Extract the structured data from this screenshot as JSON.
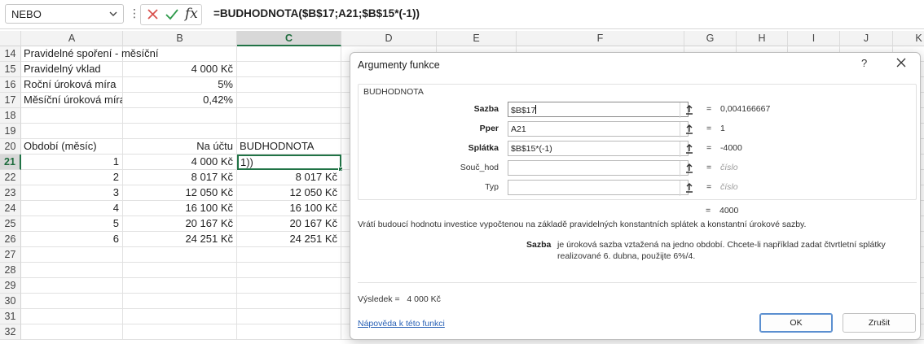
{
  "formula_bar": {
    "name_box": "NEBO",
    "formula": "=BUDHODNOTA($B$17;A21;$B$15*(-1))",
    "fx_label": "fx"
  },
  "columns": [
    "A",
    "B",
    "C",
    "D",
    "E",
    "F",
    "G",
    "H",
    "I",
    "J",
    "K"
  ],
  "selected_column": "C",
  "rows": [
    {
      "n": "14",
      "a": "Pravidelné spoření - měsíční",
      "b": "",
      "c": ""
    },
    {
      "n": "15",
      "a": "Pravidelný vklad",
      "b": "4 000 Kč",
      "c": ""
    },
    {
      "n": "16",
      "a": "Roční úroková míra",
      "b": "5%",
      "c": ""
    },
    {
      "n": "17",
      "a": "Měsíční úroková míra",
      "b": "0,42%",
      "c": ""
    },
    {
      "n": "18",
      "a": "",
      "b": "",
      "c": ""
    },
    {
      "n": "19",
      "a": "",
      "b": "",
      "c": ""
    },
    {
      "n": "20",
      "a": "Období (měsíc)",
      "b": "Na účtu",
      "c": "BUDHODNOTA"
    },
    {
      "n": "21",
      "a": "1",
      "b": "4 000 Kč",
      "c": "1))"
    },
    {
      "n": "22",
      "a": "2",
      "b": "8 017 Kč",
      "c": "8 017 Kč"
    },
    {
      "n": "23",
      "a": "3",
      "b": "12 050 Kč",
      "c": "12 050 Kč"
    },
    {
      "n": "24",
      "a": "4",
      "b": "16 100 Kč",
      "c": "16 100 Kč"
    },
    {
      "n": "25",
      "a": "5",
      "b": "20 167 Kč",
      "c": "20 167 Kč"
    },
    {
      "n": "26",
      "a": "6",
      "b": "24 251 Kč",
      "c": "24 251 Kč"
    },
    {
      "n": "27",
      "a": "",
      "b": "",
      "c": ""
    },
    {
      "n": "28",
      "a": "",
      "b": "",
      "c": ""
    },
    {
      "n": "29",
      "a": "",
      "b": "",
      "c": ""
    },
    {
      "n": "30",
      "a": "",
      "b": "",
      "c": ""
    },
    {
      "n": "31",
      "a": "",
      "b": "",
      "c": ""
    },
    {
      "n": "32",
      "a": "",
      "b": "",
      "c": ""
    }
  ],
  "dialog": {
    "title": "Argumenty funkce",
    "help_glyph": "?",
    "function_name": "BUDHODNOTA",
    "args": [
      {
        "label": "Sazba",
        "bold": true,
        "value": "$B$17",
        "result": "0,004166667",
        "empty": false
      },
      {
        "label": "Pper",
        "bold": true,
        "value": "A21",
        "result": "1",
        "empty": false
      },
      {
        "label": "Splátka",
        "bold": true,
        "value": "$B$15*(-1)",
        "result": "-4000",
        "empty": false
      },
      {
        "label": "Souč_hod",
        "bold": false,
        "value": "",
        "result": "číslo",
        "empty": true
      },
      {
        "label": "Typ",
        "bold": false,
        "value": "",
        "result": "číslo",
        "empty": true
      }
    ],
    "eq_sign": "=",
    "total_result": "4000",
    "description": "Vrátí budoucí hodnotu investice vypočtenou na základě pravidelných konstantních splátek a konstantní úrokové sazby.",
    "arg_help_name": "Sazba",
    "arg_help_text": "je úroková sazba vztažená na jedno období. Chcete-li například zadat čtvrtletní splátky realizované 6. dubna, použijte 6%/4.",
    "result_label": "Výsledek =",
    "result_value": "4 000 Kč",
    "help_link": "Nápověda k této funkci",
    "ok_label": "OK",
    "cancel_label": "Zrušit"
  },
  "colors": {
    "accent_green": "#217346",
    "link_blue": "#2a62b6",
    "cancel_red": "#d9534f",
    "confirm_green": "#2e9a4b"
  }
}
